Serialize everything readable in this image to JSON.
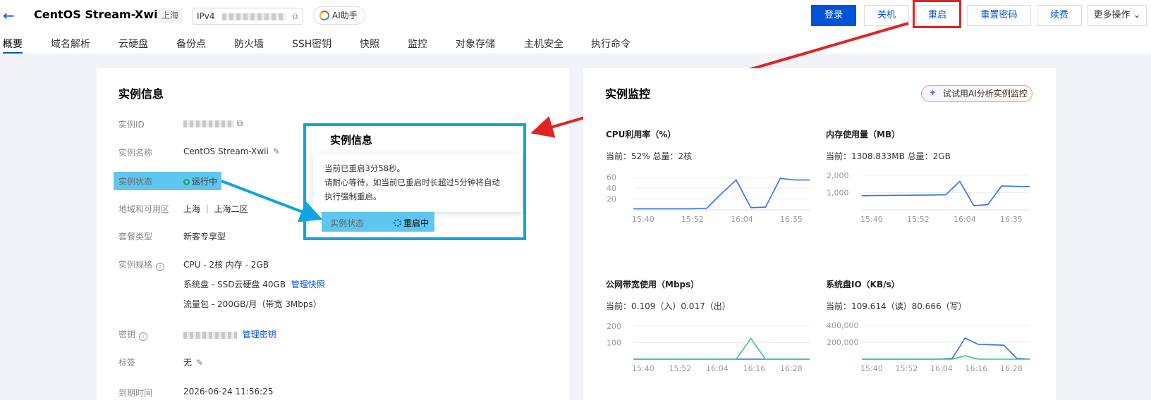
{
  "header": {
    "back_icon": "arrow-left-icon",
    "title": "CentOS Stream-Xwii",
    "region": "上海",
    "ip_label": "IPv4",
    "ai_label": "AI助手",
    "buttons": {
      "login": "登录",
      "shutdown": "关机",
      "restart": "重启",
      "reset_password": "重置密码",
      "renew": "续费",
      "more": "更多操作"
    }
  },
  "tabs": [
    "概要",
    "域名解析",
    "云硬盘",
    "备份点",
    "防火墙",
    "SSH密钥",
    "快照",
    "监控",
    "对象存储",
    "主机安全",
    "执行命令"
  ],
  "instance_info": {
    "title": "实例信息",
    "labels": {
      "id": "实例ID",
      "name": "实例名称",
      "status": "实例状态",
      "region": "地域和可用区",
      "package": "套餐类型",
      "spec": "实例规格",
      "key": "密钥",
      "tag": "标签",
      "expire": "到期时间"
    },
    "values": {
      "name": "CentOS Stream-Xwii",
      "status": "运行中",
      "region": "上海 ｜ 上海二区",
      "package": "新客专享型",
      "spec_cpu": "CPU - 2核 内存 - 2GB",
      "spec_disk": "系统盘 - SSD云硬盘 40GB",
      "spec_disk_link": "管理快照",
      "spec_traffic": "流量包 - 200GB/月（带宽 3Mbps）",
      "key_link": "管理密钥",
      "tag": "无",
      "expire": "2026-06-24 11:56:25"
    }
  },
  "popup": {
    "title": "实例信息",
    "tip_line1": "当前已重启3分58秒。",
    "tip_line2": "请耐心等待，如当前已重启时长超过5分钟将自动",
    "tip_line3": "执行强制重启。",
    "status_label": "实例状态",
    "status_value": "重启中"
  },
  "monitor": {
    "title": "实例监控",
    "ai_button": "试试用AI分析实例监控",
    "charts": {
      "cpu": {
        "title": "CPU利用率（%）",
        "current": "当前：52% 总量：2核"
      },
      "mem": {
        "title": "内存使用量（MB）",
        "current": "当前：1308.833MB 总量：2GB"
      },
      "net": {
        "title": "公网带宽使用（Mbps）",
        "current": "当前：0.109（入）0.017（出）"
      },
      "disk": {
        "title": "系统盘IO（KB/s）",
        "current": "当前：109.614（读）80.666（写）"
      }
    }
  },
  "colors": {
    "accent": "#0052d9",
    "highlight_red": "#e02424",
    "highlight_blue": "#0ea5e0",
    "line_blue": "#2f6fed",
    "line_green": "#3cc48a"
  },
  "chart_data": [
    {
      "type": "line",
      "title": "CPU利用率（%）",
      "x_ticks": [
        "15:40",
        "15:52",
        "16:04",
        "16:35"
      ],
      "y_ticks": [
        20,
        40,
        60
      ],
      "ylim": [
        0,
        70
      ],
      "series": [
        {
          "values": [
            2,
            2,
            2,
            2,
            2,
            3,
            30,
            55,
            4,
            5,
            58,
            55,
            55
          ]
        }
      ]
    },
    {
      "type": "line",
      "title": "内存使用量（MB）",
      "x_ticks": [
        "15:40",
        "15:52",
        "16:04",
        "16:35"
      ],
      "y_ticks": [
        "1,000",
        "2,000"
      ],
      "ylim": [
        0,
        2200
      ],
      "series": [
        {
          "values": [
            820,
            830,
            840,
            845,
            850,
            860,
            870,
            1650,
            250,
            300,
            1380,
            1360,
            1350
          ]
        }
      ]
    },
    {
      "type": "line",
      "title": "公网带宽使用（Mbps）",
      "x_ticks": [
        "15:40",
        "15:52",
        "16:04",
        "16:16",
        "16:28"
      ],
      "y_ticks": [
        100,
        200
      ],
      "ylim": [
        0,
        230
      ],
      "series": [
        {
          "values": [
            0,
            0,
            0,
            0,
            0,
            0,
            0,
            0,
            0,
            0,
            0,
            0,
            0
          ]
        },
        {
          "values": [
            0,
            0,
            0,
            0,
            0,
            0,
            0,
            0,
            125,
            0,
            0,
            0,
            0
          ]
        }
      ]
    },
    {
      "type": "line",
      "title": "系统盘IO（KB/s）",
      "x_ticks": [
        "15:40",
        "15:52",
        "16:04",
        "16:16",
        "16:28"
      ],
      "y_ticks": [
        "200,000",
        "400,000"
      ],
      "ylim": [
        0,
        450000
      ],
      "series": [
        {
          "values": [
            0,
            0,
            0,
            0,
            0,
            0,
            0,
            10000,
            250000,
            175000,
            170000,
            165000,
            10000,
            0
          ]
        },
        {
          "values": [
            0,
            0,
            0,
            0,
            0,
            0,
            0,
            0,
            40000,
            0,
            0,
            0,
            0,
            0
          ]
        }
      ]
    }
  ]
}
